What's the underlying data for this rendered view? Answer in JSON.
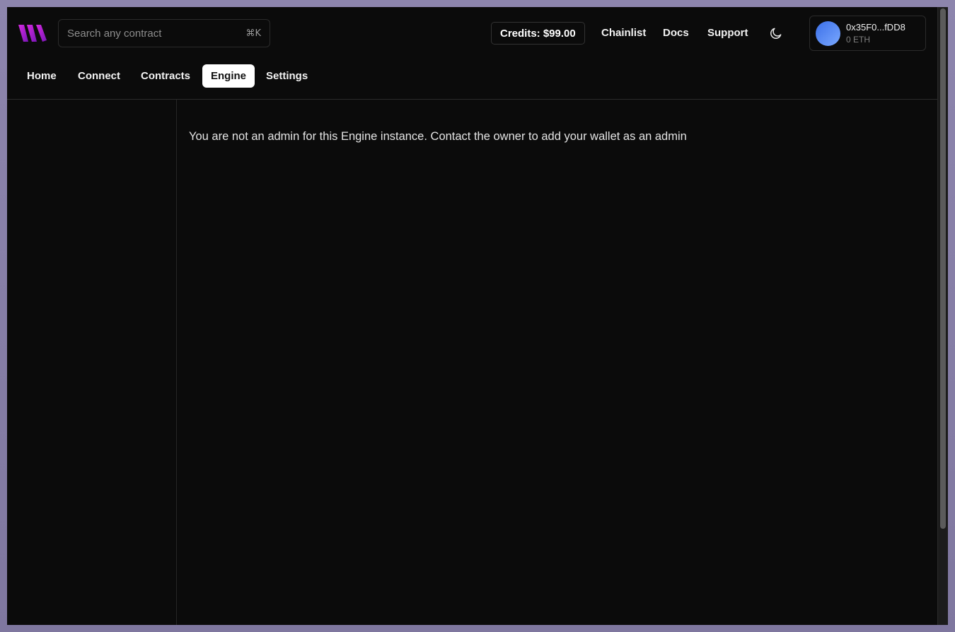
{
  "header": {
    "search": {
      "placeholder": "Search any contract",
      "shortcut": "⌘K"
    },
    "credits_label": "Credits: $99.00",
    "links": [
      "Chainlist",
      "Docs",
      "Support"
    ],
    "theme_icon": "moon-icon",
    "wallet": {
      "address": "0x35F0...fDD8",
      "balance": "0 ETH"
    }
  },
  "nav": {
    "tabs": [
      {
        "label": "Home",
        "active": false
      },
      {
        "label": "Connect",
        "active": false
      },
      {
        "label": "Contracts",
        "active": false
      },
      {
        "label": "Engine",
        "active": true
      },
      {
        "label": "Settings",
        "active": false
      }
    ]
  },
  "main": {
    "message": "You are not an admin for this Engine instance. Contact the owner to add your wallet as an admin"
  },
  "colors": {
    "background": "#0b0b0b",
    "logo_gradient_start": "#c21fd6",
    "logo_gradient_end": "#7a16b8",
    "active_tab_bg": "#ffffff",
    "avatar_start": "#3b6fe8",
    "avatar_end": "#7aa8ff"
  }
}
